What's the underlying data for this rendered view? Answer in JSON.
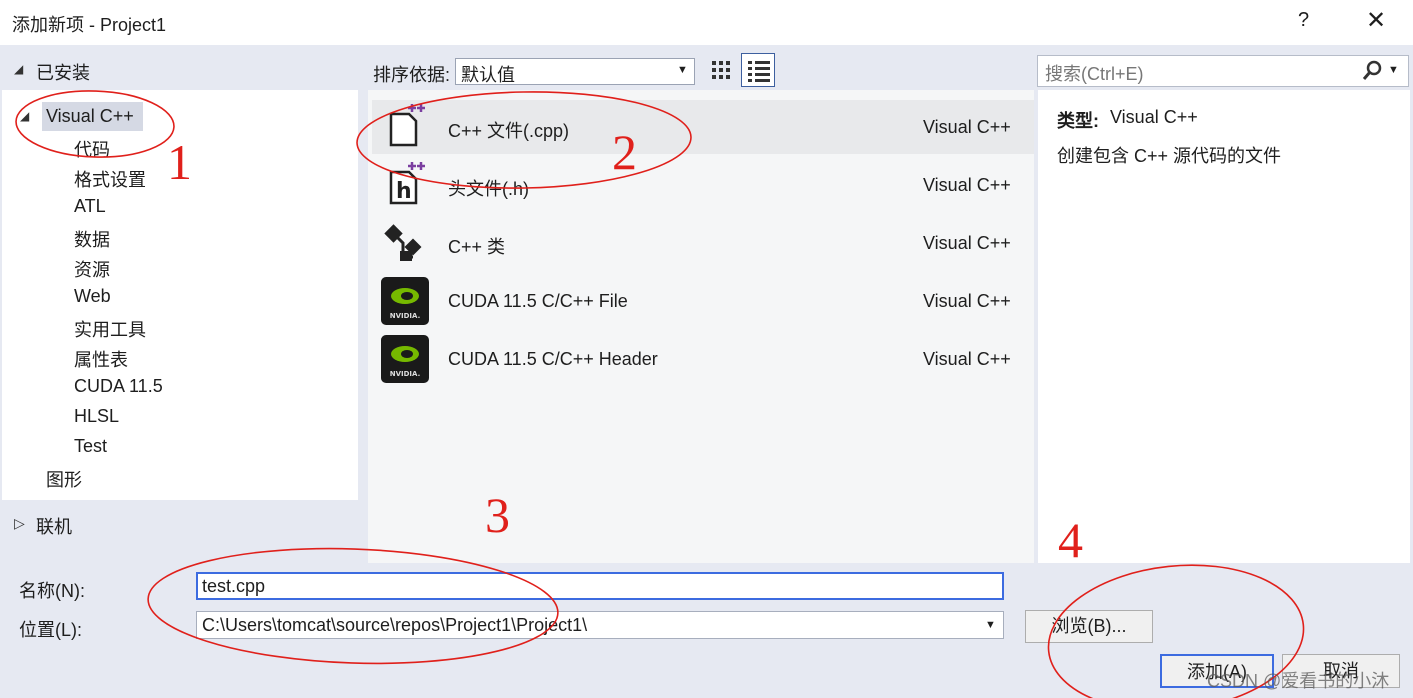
{
  "window": {
    "title": "添加新项 - Project1",
    "help": "?",
    "close": "✕"
  },
  "left_panel": {
    "installed": "已安装",
    "visual_cpp": "Visual C++",
    "children": [
      "代码",
      "格式设置",
      "ATL",
      "数据",
      "资源",
      "Web",
      "实用工具",
      "属性表",
      "CUDA 11.5",
      "HLSL",
      "Test"
    ],
    "graphics": "图形",
    "online": "联机"
  },
  "toolbar": {
    "sort_label": "排序依据:",
    "sort_value": "默认值",
    "search_placeholder": "搜索(Ctrl+E)"
  },
  "templates": [
    {
      "label": "C++ 文件(.cpp)",
      "lang": "Visual C++",
      "icon": "cpp-file-icon"
    },
    {
      "label": "头文件(.h)",
      "lang": "Visual C++",
      "icon": "header-file-icon"
    },
    {
      "label": "C++ 类",
      "lang": "Visual C++",
      "icon": "cpp-class-icon"
    },
    {
      "label": "CUDA 11.5 C/C++ File",
      "lang": "Visual C++",
      "icon": "nvidia-icon"
    },
    {
      "label": "CUDA 11.5 C/C++ Header",
      "lang": "Visual C++",
      "icon": "nvidia-icon"
    }
  ],
  "detail": {
    "type_label": "类型:",
    "type_value": "Visual C++",
    "description": "创建包含 C++ 源代码的文件"
  },
  "form": {
    "name_label": "名称(N):",
    "name_value": "test.cpp",
    "location_label": "位置(L):",
    "location_value": "C:\\Users\\tomcat\\source\\repos\\Project1\\Project1\\",
    "browse_label": "浏览(B)...",
    "add_label": "添加(A)",
    "cancel_label": "取消"
  },
  "annotations": [
    "1",
    "2",
    "3",
    "4"
  ],
  "watermark": "CSDN @爱看书的小沐",
  "colors": {
    "annotation_red": "#e0201b",
    "panel_bg": "#e6e9f2",
    "selection_bg": "#e8e9eb",
    "focus_border": "#3c6be0"
  }
}
